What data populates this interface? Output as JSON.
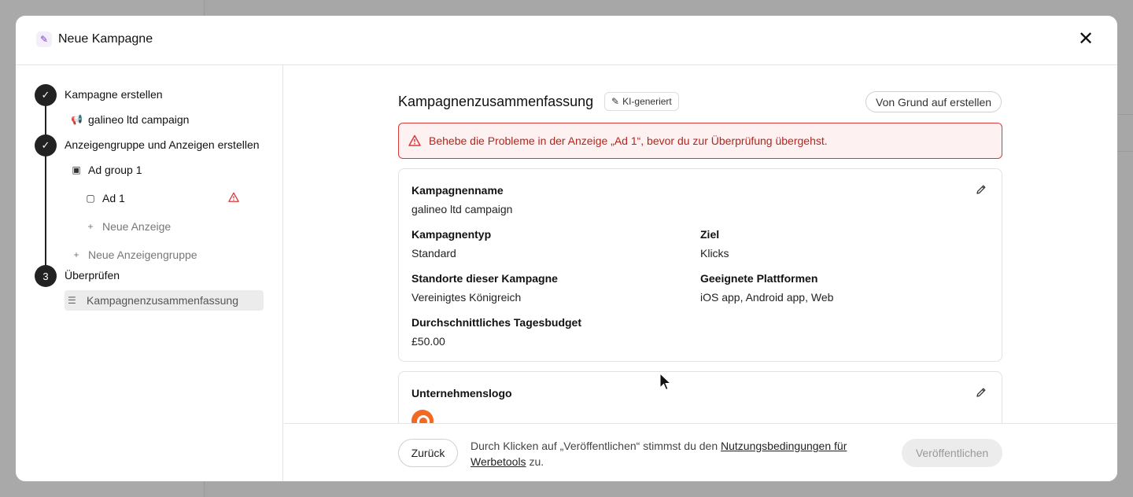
{
  "modal": {
    "title": "Neue Kampagne",
    "close_label": "✕"
  },
  "stepper": {
    "step1": {
      "label": "Kampagne erstellen",
      "status": "done"
    },
    "campaign_item": "galineo ltd campaign",
    "step2": {
      "label": "Anzeigengruppe und Anzeigen erstellen",
      "status": "done"
    },
    "ad_group_item": "Ad group 1",
    "ad_item": "Ad 1",
    "new_ad": "Neue Anzeige",
    "new_ad_group": "Neue Anzeigengruppe",
    "step3": {
      "label": "Überprüfen",
      "number": "3"
    },
    "summary_item": "Kampagnenzusammenfassung"
  },
  "summary": {
    "title": "Kampagnenzusammenfassung",
    "ai_badge": "KI-generiert",
    "scratch_button": "Von Grund auf erstellen",
    "alert": "Behebe die Probleme in der Anzeige „Ad 1“, bevor du zur Überprüfung übergehst.",
    "campaign_name_label": "Kampagnenname",
    "campaign_name_value": "galineo ltd campaign",
    "campaign_type_label": "Kampagnentyp",
    "campaign_type_value": "Standard",
    "goal_label": "Ziel",
    "goal_value": "Klicks",
    "locations_label": "Standorte dieser Kampagne",
    "locations_value": "Vereinigtes Königreich",
    "platforms_label": "Geeignete Plattformen",
    "platforms_value": "iOS app, Android app, Web",
    "budget_label": "Durchschnittliches Tagesbudget",
    "budget_value": "£50.00",
    "logo_label": "Unternehmenslogo"
  },
  "footer": {
    "back_button": "Zurück",
    "legal_prefix": "Durch Klicken auf „Veröffentlichen“ stimmst du den ",
    "legal_link": "Nutzungsbedingungen für Werbetools",
    "legal_suffix": " zu.",
    "publish_button": "Veröffentlichen"
  },
  "colors": {
    "alert_border": "#d63a3a",
    "alert_bg": "#fdf1f1",
    "logo": "#f26a21",
    "step_dark": "#222222"
  }
}
